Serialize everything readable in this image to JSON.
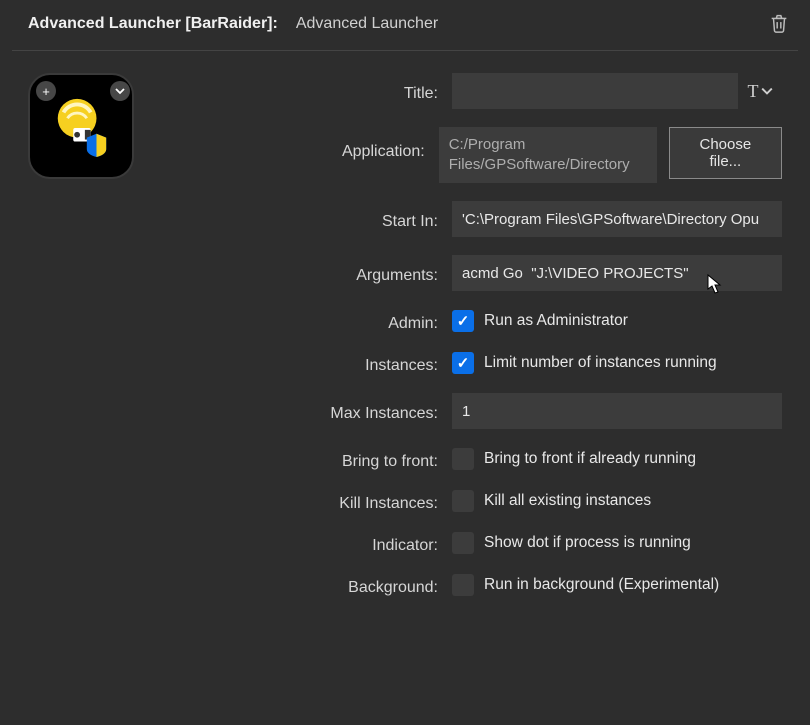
{
  "header": {
    "title": "Advanced Launcher [BarRaider]:",
    "subtitle": "Advanced Launcher"
  },
  "labels": {
    "title": "Title:",
    "application": "Application:",
    "startIn": "Start In:",
    "arguments": "Arguments:",
    "admin": "Admin:",
    "instances": "Instances:",
    "maxInstances": "Max Instances:",
    "bringToFront": "Bring to front:",
    "killInstances": "Kill Instances:",
    "indicator": "Indicator:",
    "background": "Background:"
  },
  "fields": {
    "titleValue": "",
    "applicationPath": "C:/Program Files/GPSoftware/Directory",
    "chooseFile": "Choose file...",
    "startInValue": "'C:\\Program Files\\GPSoftware\\Directory Opu",
    "argumentsValue": "acmd Go  \"J:\\VIDEO PROJECTS\"",
    "adminLabel": "Run as Administrator",
    "adminChecked": true,
    "instancesLabel": "Limit number of instances running",
    "instancesChecked": true,
    "maxInstancesValue": "1",
    "bringToFrontLabel": "Bring to front if already running",
    "bringToFrontChecked": false,
    "killInstancesLabel": "Kill all existing instances",
    "killInstancesChecked": false,
    "indicatorLabel": "Show dot if process is running",
    "indicatorChecked": false,
    "backgroundLabel": "Run in background (Experimental)",
    "backgroundChecked": false
  },
  "titleStyleGlyph": "T"
}
